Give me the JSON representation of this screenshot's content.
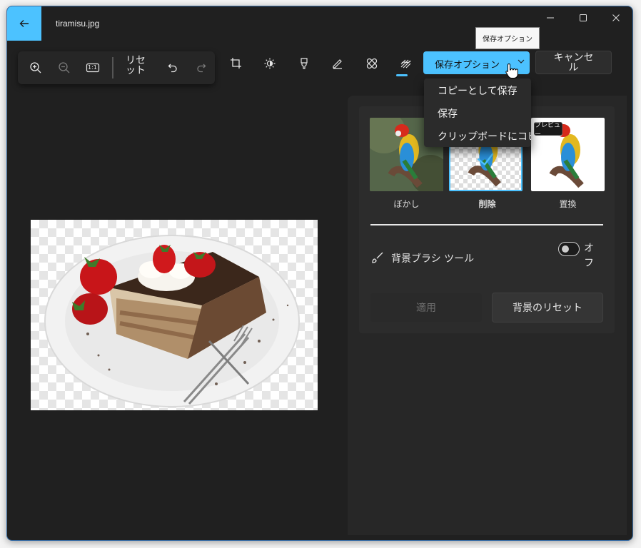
{
  "window": {
    "title": "tiramisu.jpg"
  },
  "toolbar": {
    "reset_label": "リセ\nット",
    "zoom_ratio_label": "1:1"
  },
  "actions": {
    "save_options_label": "保存オプション",
    "cancel_label": "キャンセ\nル",
    "save_options_tooltip": "保存オプション"
  },
  "save_menu": {
    "items": [
      {
        "label": "コピーとして保存"
      },
      {
        "label": "保存"
      },
      {
        "label": "クリップボードにコピー"
      }
    ]
  },
  "background_panel": {
    "options": [
      {
        "label": "ぼかし"
      },
      {
        "label": "削除"
      },
      {
        "label": "置換"
      }
    ],
    "preview_tooltip": "プレビュー",
    "brush_tool_label": "背景ブラシ ツール",
    "brush_toggle_state": "オ\nフ",
    "apply_label": "適用",
    "reset_background_label": "背景のリセット"
  },
  "colors": {
    "accent": "#4cc2ff",
    "window_bg": "#202020",
    "panel_bg": "#272727"
  }
}
